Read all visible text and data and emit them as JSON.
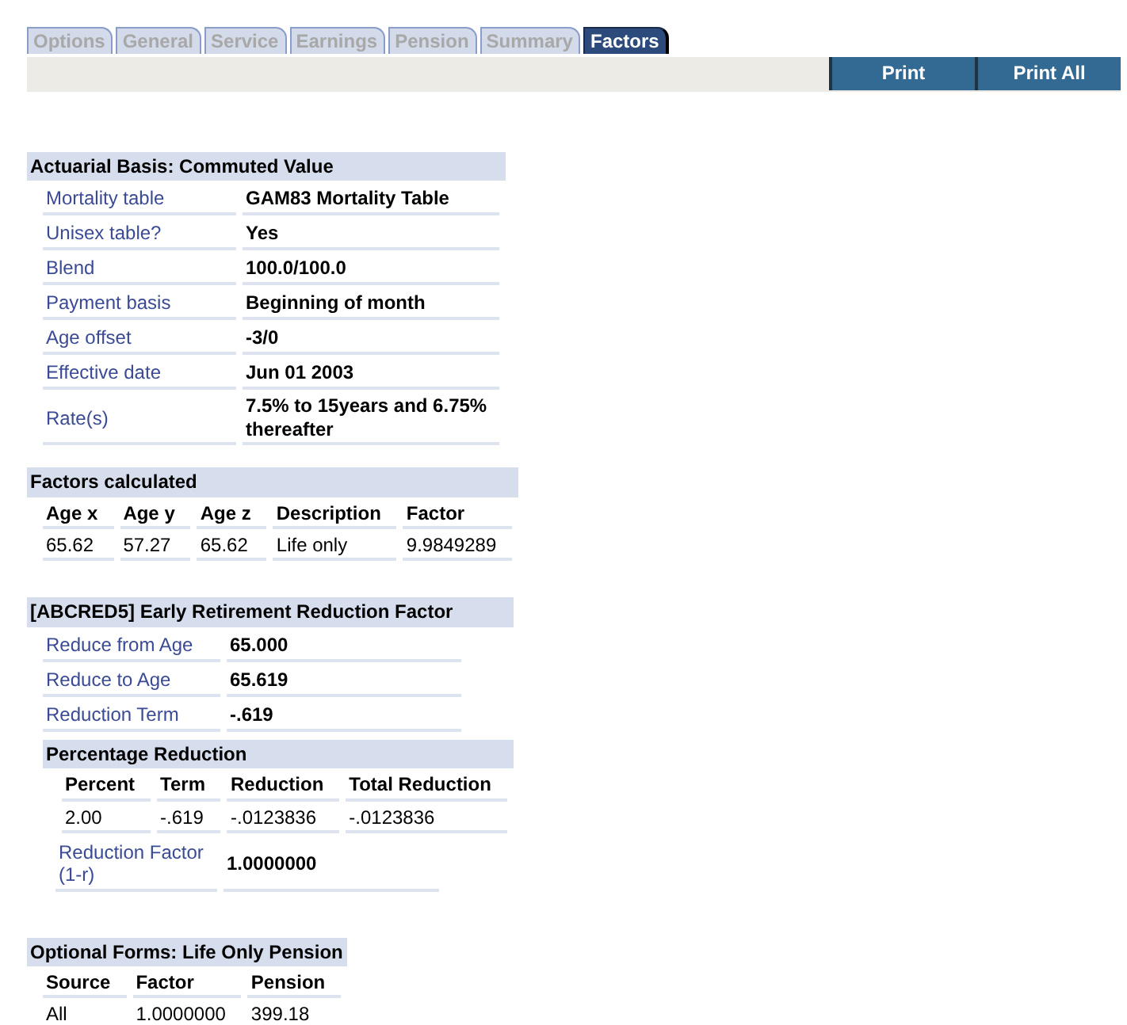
{
  "tabs": [
    {
      "label": "Options",
      "selected": false
    },
    {
      "label": "General",
      "selected": false
    },
    {
      "label": "Service",
      "selected": false
    },
    {
      "label": "Earnings",
      "selected": false
    },
    {
      "label": "Pension",
      "selected": false
    },
    {
      "label": "Summary",
      "selected": false
    },
    {
      "label": "Factors",
      "selected": true
    }
  ],
  "toolbar": {
    "buttons": [
      "Print",
      "Print All"
    ]
  },
  "sections": [
    {
      "kind": "fields",
      "title": "Actuarial Basis: Commuted Value",
      "rows": [
        {
          "label": "Mortality table",
          "value": "GAM83 Mortality Table"
        },
        {
          "label": "Unisex table?",
          "value": "Yes"
        },
        {
          "label": "Blend",
          "value": "100.0/100.0"
        },
        {
          "label": "Payment basis",
          "value": "Beginning of month"
        },
        {
          "label": "Age offset",
          "value": "-3/0"
        },
        {
          "label": "Effective date",
          "value": "Jun 01 2003"
        },
        {
          "label": "Rate(s)",
          "value": "7.5% to 15years and 6.75% thereafter"
        }
      ]
    },
    {
      "kind": "table",
      "title": "Factors calculated",
      "columns": [
        "Age x",
        "Age y",
        "Age z",
        "Description",
        "Factor"
      ],
      "rows": [
        [
          "65.62",
          "57.27",
          "65.62",
          "Life only",
          "9.9849289"
        ]
      ]
    },
    {
      "kind": "fields",
      "title": "[ABCRED5] Early Retirement Reduction Factor",
      "rows": [
        {
          "label": "Reduce from Age",
          "value": "65.000"
        },
        {
          "label": "Reduce to Age",
          "value": "65.619"
        },
        {
          "label": "Reduction Term",
          "value": "-.619"
        }
      ],
      "subsection": {
        "title": "Percentage Reduction",
        "columns": [
          "Percent",
          "Term",
          "Reduction",
          "Total Reduction"
        ],
        "rows": [
          [
            "2.00",
            "-.619",
            "-.0123836",
            "-.0123836"
          ]
        ],
        "fields": [
          {
            "label": "Reduction Factor (1-r)",
            "value": "1.0000000"
          }
        ]
      }
    },
    {
      "kind": "table",
      "title": "Optional Forms: Life Only Pension",
      "columns": [
        "Source",
        "Factor",
        "Pension"
      ],
      "rows": [
        [
          "All",
          "1.0000000",
          "399.18"
        ]
      ]
    }
  ]
}
